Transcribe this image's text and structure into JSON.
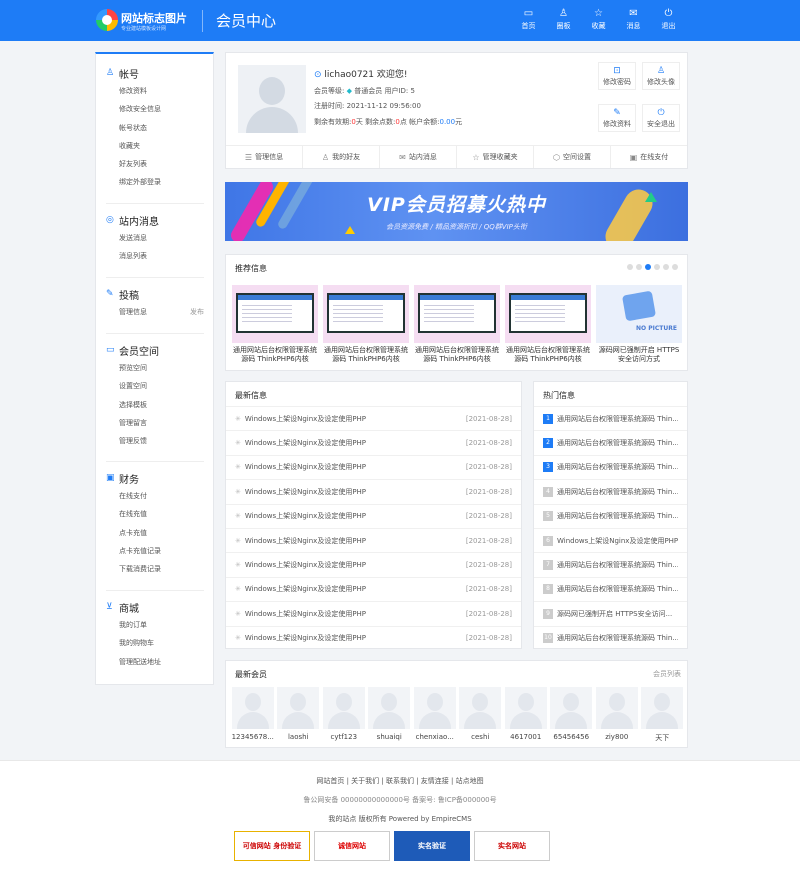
{
  "header": {
    "site_name": "网站标志图片",
    "site_sub": "专业建站模板设计网",
    "page_title": "会员中心",
    "nav": [
      {
        "icon": "monitor-icon",
        "label": "首页"
      },
      {
        "icon": "user-icon",
        "label": "圈板"
      },
      {
        "icon": "star-icon",
        "label": "收藏"
      },
      {
        "icon": "mail-icon",
        "label": "消息"
      },
      {
        "icon": "power-icon",
        "label": "退出"
      }
    ]
  },
  "sidebar": {
    "groups": [
      {
        "icon": "user-icon",
        "title": "帐号",
        "items": [
          {
            "label": "修改资料"
          },
          {
            "label": "修改安全信息"
          },
          {
            "label": "帐号状态"
          },
          {
            "label": "收藏夹"
          },
          {
            "label": "好友列表"
          },
          {
            "label": "绑定外部登录"
          }
        ]
      },
      {
        "icon": "chat-icon",
        "title": "站内消息",
        "items": [
          {
            "label": "发送消息"
          },
          {
            "label": "消息列表"
          }
        ]
      },
      {
        "icon": "pen-icon",
        "title": "投稿",
        "items": [
          {
            "label": "管理信息",
            "extra": "发布"
          }
        ]
      },
      {
        "icon": "monitor-icon",
        "title": "会员空间",
        "items": [
          {
            "label": "预览空间"
          },
          {
            "label": "设置空间"
          },
          {
            "label": "选择模板"
          },
          {
            "label": "管理留言"
          },
          {
            "label": "管理反馈"
          }
        ]
      },
      {
        "icon": "wallet-icon",
        "title": "财务",
        "items": [
          {
            "label": "在线支付"
          },
          {
            "label": "在线充值"
          },
          {
            "label": "点卡充值"
          },
          {
            "label": "点卡充值记录"
          },
          {
            "label": "下载消费记录"
          }
        ]
      },
      {
        "icon": "cart-icon",
        "title": "商城",
        "items": [
          {
            "label": "我的订单"
          },
          {
            "label": "我的购物车"
          },
          {
            "label": "管理配送地址"
          }
        ]
      }
    ]
  },
  "profile": {
    "username": "lichao0721",
    "welcome": " 欢迎您!",
    "level_label": "会员等级:",
    "level": "普通会员",
    "uid_label": "用户ID:",
    "uid": "5",
    "reg_label": "注册时间:",
    "reg_time": "2021-11-12 09:56:00",
    "days_label": "剩余有效期:",
    "days": "0",
    "days_unit": "天",
    "points_label": "剩余点数:",
    "points": "0",
    "points_unit": "点",
    "balance_label": "帐户余额:",
    "balance": "0.00",
    "balance_unit": "元",
    "actions": [
      {
        "icon": "lock-icon",
        "label": "修改密码"
      },
      {
        "icon": "user-edit-icon",
        "label": "修改头像"
      },
      {
        "icon": "edit-icon",
        "label": "修改资料"
      },
      {
        "icon": "power-icon",
        "label": "安全退出"
      }
    ],
    "tabs": [
      {
        "icon": "list-icon",
        "label": "管理信息"
      },
      {
        "icon": "user-icon",
        "label": "我的好友"
      },
      {
        "icon": "mail-icon",
        "label": "站内消息"
      },
      {
        "icon": "star-icon",
        "label": "管理收藏夹"
      },
      {
        "icon": "cube-icon",
        "label": "空间设置"
      },
      {
        "icon": "wallet-icon",
        "label": "在线支付"
      }
    ]
  },
  "banner": {
    "title": "VIP会员招募火热中",
    "subtitle": "会员资源免费 / 精品资源折扣 / QQ群VIP头衔"
  },
  "recommend": {
    "title": "推荐信息",
    "items": [
      {
        "title": "通用网站后台权限管理系统源码 ThinkPHP6内核"
      },
      {
        "title": "通用网站后台权限管理系统源码 ThinkPHP6内核"
      },
      {
        "title": "通用网站后台权限管理系统源码 ThinkPHP6内核"
      },
      {
        "title": "通用网站后台权限管理系统源码 ThinkPHP6内核"
      },
      {
        "title": "源码网已强制开启 HTTPS安全访问方式",
        "placeholder_text": "NO PICTURE"
      }
    ]
  },
  "latest": {
    "title": "最新信息",
    "items": [
      {
        "title": "Windows上架设Nginx及设定使用PHP",
        "date": "[2021-08-28]"
      },
      {
        "title": "Windows上架设Nginx及设定使用PHP",
        "date": "[2021-08-28]"
      },
      {
        "title": "Windows上架设Nginx及设定使用PHP",
        "date": "[2021-08-28]"
      },
      {
        "title": "Windows上架设Nginx及设定使用PHP",
        "date": "[2021-08-28]"
      },
      {
        "title": "Windows上架设Nginx及设定使用PHP",
        "date": "[2021-08-28]"
      },
      {
        "title": "Windows上架设Nginx及设定使用PHP",
        "date": "[2021-08-28]"
      },
      {
        "title": "Windows上架设Nginx及设定使用PHP",
        "date": "[2021-08-28]"
      },
      {
        "title": "Windows上架设Nginx及设定使用PHP",
        "date": "[2021-08-28]"
      },
      {
        "title": "Windows上架设Nginx及设定使用PHP",
        "date": "[2021-08-28]"
      },
      {
        "title": "Windows上架设Nginx及设定使用PHP",
        "date": "[2021-08-28]"
      }
    ]
  },
  "hot": {
    "title": "热门信息",
    "items": [
      {
        "rank": "1",
        "title": "通用网站后台权限管理系统源码 Thin..."
      },
      {
        "rank": "2",
        "title": "通用网站后台权限管理系统源码 Thin..."
      },
      {
        "rank": "3",
        "title": "通用网站后台权限管理系统源码 Thin..."
      },
      {
        "rank": "4",
        "title": "通用网站后台权限管理系统源码 Thin..."
      },
      {
        "rank": "5",
        "title": "通用网站后台权限管理系统源码 Thin..."
      },
      {
        "rank": "6",
        "title": "Windows上架设Nginx及设定使用PHP"
      },
      {
        "rank": "7",
        "title": "通用网站后台权限管理系统源码 Thin..."
      },
      {
        "rank": "8",
        "title": "通用网站后台权限管理系统源码 Thin..."
      },
      {
        "rank": "9",
        "title": "源码网已强制开启 HTTPS安全访问..."
      },
      {
        "rank": "10",
        "title": "通用网站后台权限管理系统源码 Thin..."
      }
    ]
  },
  "members": {
    "title": "最新会员",
    "link": "会员列表",
    "list": [
      {
        "name": "12345678..."
      },
      {
        "name": "laoshi"
      },
      {
        "name": "cytf123"
      },
      {
        "name": "shuaiqi"
      },
      {
        "name": "chenxiao..."
      },
      {
        "name": "ceshi"
      },
      {
        "name": "4617001"
      },
      {
        "name": "65456456"
      },
      {
        "name": "ziy800"
      },
      {
        "name": "天下"
      }
    ]
  },
  "footer": {
    "links": "网站首页 | 关于我们 | 联系我们 | 友情连接 | 站点地图",
    "record": "鲁公网安备 00000000000000号 备案号: 鲁ICP备000000号",
    "copyright": "我的站点 版权所有 Powered by EmpireCMS",
    "badges": [
      "可信网站 身份验证",
      "诚信网站",
      "实名验证",
      "实名网站"
    ]
  }
}
